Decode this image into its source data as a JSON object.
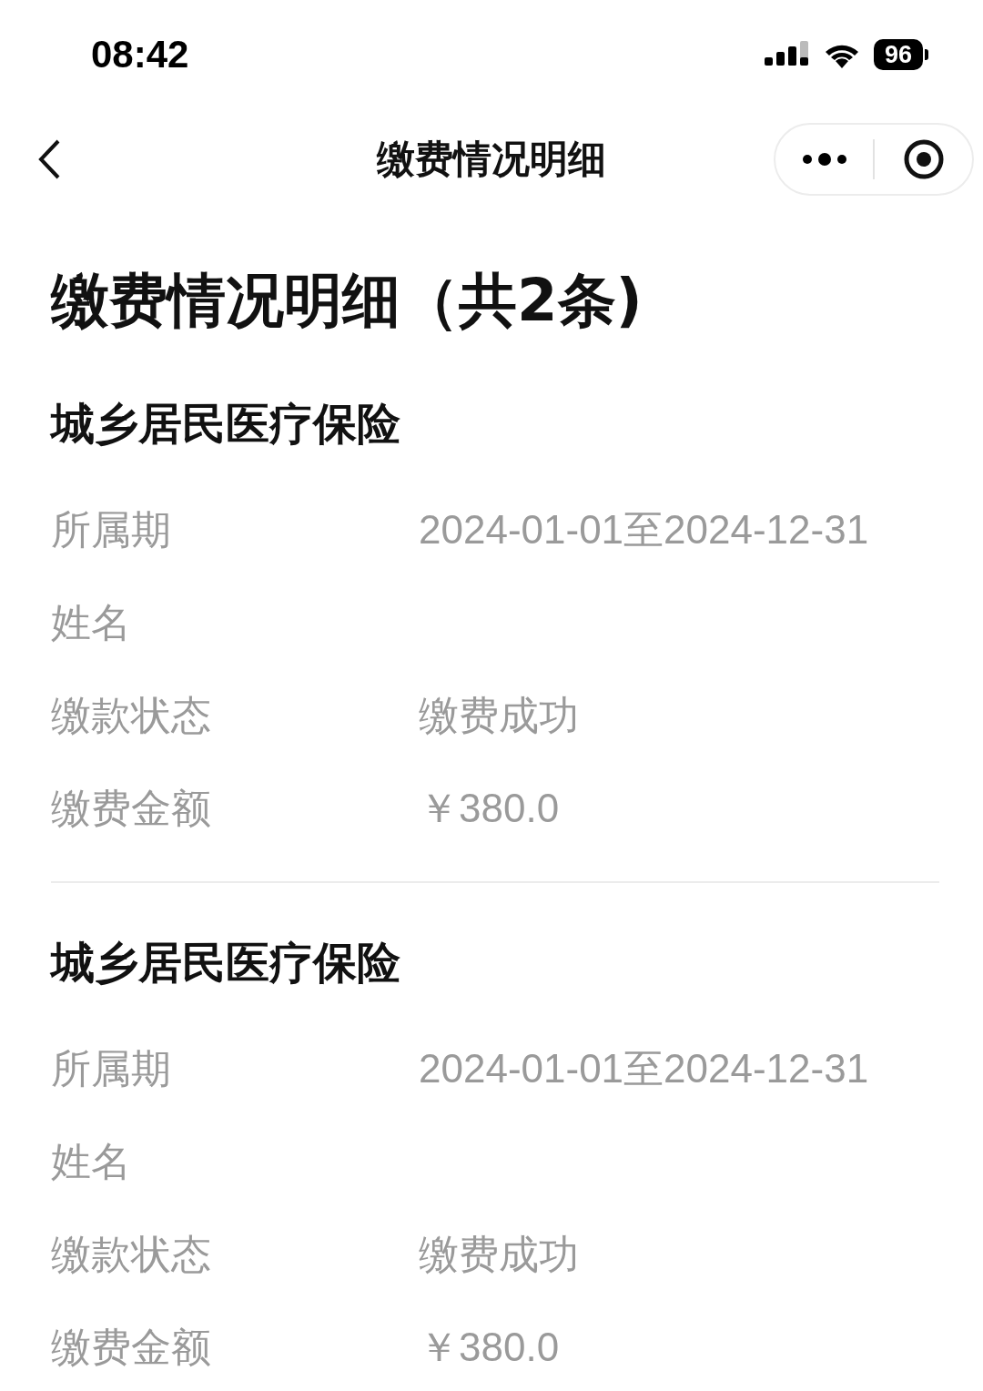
{
  "status_bar": {
    "time": "08:42",
    "battery": "96"
  },
  "nav_bar": {
    "title": "缴费情况明细"
  },
  "heading": "缴费情况明细（共2条)",
  "records": [
    {
      "title": "城乡居民医疗保险",
      "fields": [
        {
          "label": "所属期",
          "value": "2024-01-01至2024-12-31"
        },
        {
          "label": "姓名"
        },
        {
          "label": "缴款状态",
          "value": "缴费成功"
        },
        {
          "label": "缴费金额",
          "value": "￥380.0"
        }
      ]
    },
    {
      "title": "城乡居民医疗保险",
      "fields": [
        {
          "label": "所属期",
          "value": "2024-01-01至2024-12-31"
        },
        {
          "label": "姓名"
        },
        {
          "label": "缴款状态",
          "value": "缴费成功"
        },
        {
          "label": "缴费金额",
          "value": "￥380.0"
        }
      ]
    }
  ]
}
